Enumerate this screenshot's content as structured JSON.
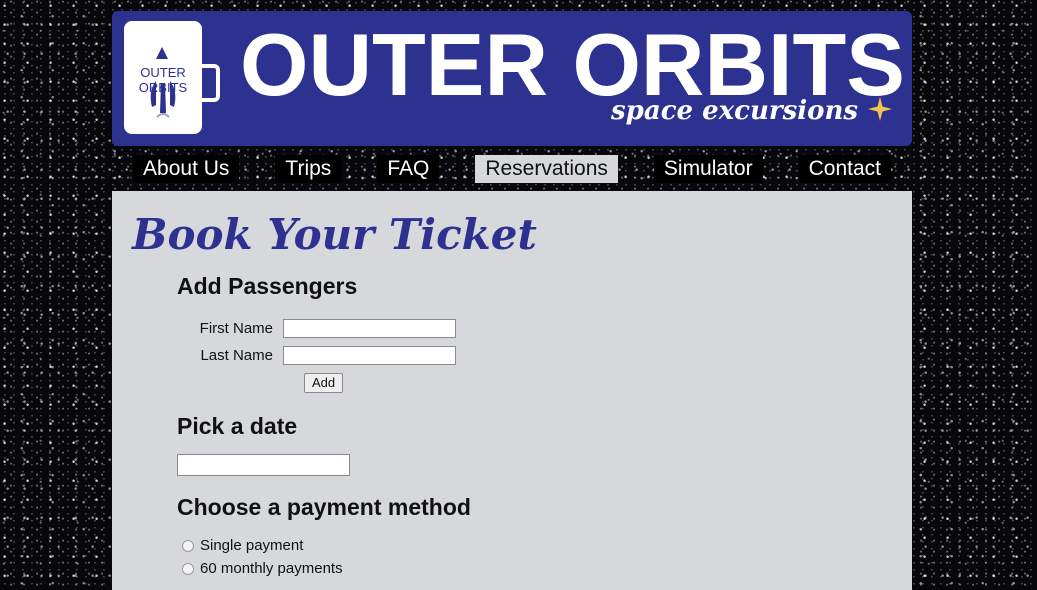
{
  "header": {
    "logo_line1": "OUTER",
    "logo_line2": "ORBITS",
    "title": "OUTER ORBITS",
    "subtitle": "space excursions"
  },
  "nav": {
    "items": [
      {
        "label": "About Us"
      },
      {
        "label": "Trips"
      },
      {
        "label": "FAQ"
      },
      {
        "label": "Reservations",
        "active": true
      },
      {
        "label": "Simulator"
      },
      {
        "label": "Contact"
      }
    ]
  },
  "main": {
    "title": "Book Your Ticket",
    "passengers": {
      "heading": "Add Passengers",
      "first_name_label": "First Name",
      "first_name_value": "",
      "last_name_label": "Last Name",
      "last_name_value": "",
      "add_button": "Add"
    },
    "date": {
      "heading": "Pick a date",
      "value": ""
    },
    "payment": {
      "heading": "Choose a payment method",
      "options": [
        {
          "label": "Single payment",
          "selected": false
        },
        {
          "label": "60 monthly payments",
          "selected": false
        }
      ]
    }
  },
  "colors": {
    "brand": "#2d3190",
    "panel": "#d6d8db",
    "sparkle": "#f4c05a"
  },
  "icons": {
    "logo": "rocket-mug-logo-icon",
    "sparkle": "sparkle-icon"
  }
}
